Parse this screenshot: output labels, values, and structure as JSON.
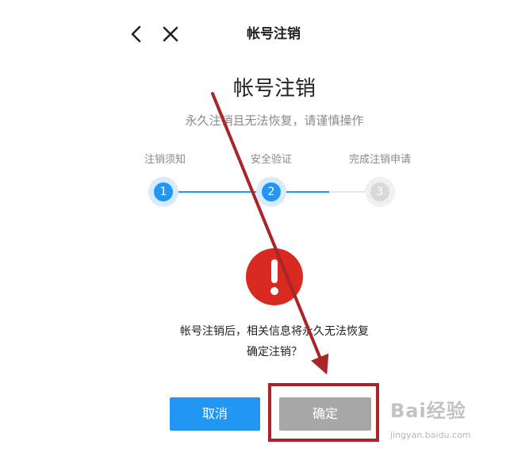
{
  "nav": {
    "back_icon": "chevron-left-icon",
    "close_icon": "close-icon",
    "title": "帐号注销"
  },
  "header": {
    "title": "帐号注销",
    "subtitle": "永久注销且无法恢复，请谨慎操作"
  },
  "steps": [
    {
      "label": "注销须知",
      "number": "1",
      "state": "done"
    },
    {
      "label": "安全验证",
      "number": "2",
      "state": "current"
    },
    {
      "label": "完成注销申请",
      "number": "3",
      "state": "pending"
    }
  ],
  "warning": {
    "icon": "exclamation-icon",
    "message_line1": "帐号注销后，相关信息将永久无法恢复",
    "message_line2": "确定注销？"
  },
  "buttons": {
    "cancel": "取消",
    "confirm": "确定"
  },
  "watermark": {
    "logo": "Bai经验",
    "url": "jingyan.baidu.com"
  },
  "colors": {
    "primary": "#2196f3",
    "step_done": "#2196f3",
    "step_pending": "#d9d9d9",
    "warning": "#d92a22",
    "confirm_bg": "#a7a7a7",
    "annotation": "#a8252a"
  }
}
